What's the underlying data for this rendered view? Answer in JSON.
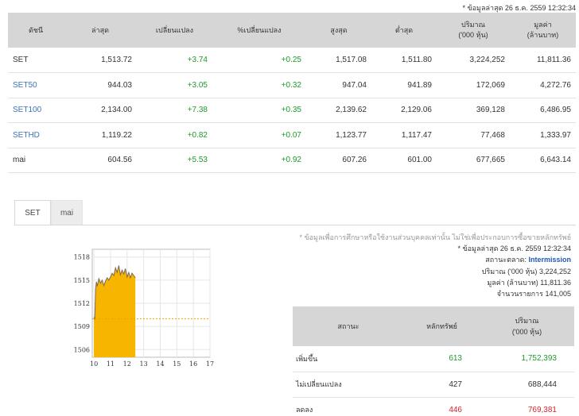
{
  "top_note": "* ข้อมูลล่าสุด 26 ธ.ค. 2559 12:32:34",
  "index_table": {
    "headers": [
      "ดัชนี",
      "ล่าสุด",
      "เปลี่ยนแปลง",
      "%เปลี่ยนแปลง",
      "สูงสุด",
      "ต่ำสุด",
      "ปริมาณ",
      "('000 หุ้น)",
      "มูลค่า",
      "(ล้านบาท)"
    ],
    "rows": [
      {
        "name": "SET",
        "last": "1,513.72",
        "change": "+3.74",
        "pct": "+0.25",
        "high": "1,517.08",
        "low": "1,511.80",
        "volume": "3,224,252",
        "value": "11,811.36"
      },
      {
        "name": "SET50",
        "last": "944.03",
        "change": "+3.05",
        "pct": "+0.32",
        "high": "947.04",
        "low": "941.89",
        "volume": "172,069",
        "value": "4,272.76"
      },
      {
        "name": "SET100",
        "last": "2,134.00",
        "change": "+7.38",
        "pct": "+0.35",
        "high": "2,139.62",
        "low": "2,129.06",
        "volume": "369,128",
        "value": "6,486.95"
      },
      {
        "name": "SETHD",
        "last": "1,119.22",
        "change": "+0.82",
        "pct": "+0.07",
        "high": "1,123.77",
        "low": "1,117.47",
        "volume": "77,468",
        "value": "1,333.97"
      },
      {
        "name": "mai",
        "last": "604.56",
        "change": "+5.53",
        "pct": "+0.92",
        "high": "607.26",
        "low": "601.00",
        "volume": "677,665",
        "value": "6,643.14"
      }
    ]
  },
  "tabs": [
    {
      "label": "SET",
      "active": true
    },
    {
      "label": "mai",
      "active": false
    }
  ],
  "info": {
    "disclaimer": "* ข้อมูลเพื่อการศึกษาหรือใช้งานส่วนบุคคลเท่านั้น ไม่ใช่เพื่อประกอบการซื้อขายหลักทรัพย์",
    "updated": "* ข้อมูลล่าสุด 26 ธ.ค. 2559 12:32:34",
    "market_status_label": "สถานะตลาด:",
    "market_status_value": "Intermission",
    "volume_label": "ปริมาณ ('000 หุ้น)",
    "volume_value": "3,224,252",
    "value_label": "มูลค่า (ล้านบาท)",
    "value_value": "11,811.36",
    "trades_label": "จำนวนรายการ",
    "trades_value": "141,005"
  },
  "stat_table": {
    "headers": [
      "สถานะ",
      "หลักทรัพย์",
      "ปริมาณ",
      "('000 หุ้น)"
    ],
    "rows": [
      {
        "label": "เพิ่มขึ้น",
        "count": "613",
        "volume": "1,752,393",
        "color": "#1f9a2b"
      },
      {
        "label": "ไม่เปลี่ยนแปลง",
        "count": "427",
        "volume": "688,444",
        "color": "#333333"
      },
      {
        "label": "ลดลง",
        "count": "446",
        "volume": "769,381",
        "color": "#d9262b"
      }
    ]
  },
  "chart_data": {
    "type": "area",
    "x_ticks": [
      "10",
      "11",
      "12",
      "13",
      "14",
      "15",
      "16",
      "17"
    ],
    "y_ticks": [
      "1518",
      "1515",
      "1512",
      "1509",
      "1506"
    ],
    "xlim": [
      9.9,
      17
    ],
    "ylim": [
      1505,
      1519
    ],
    "prev_close": 1509.98,
    "fill_color": "#f7b500",
    "x": [
      10.0,
      10.05,
      10.1,
      10.15,
      10.2,
      10.3,
      10.4,
      10.5,
      10.6,
      10.7,
      10.8,
      10.9,
      11.0,
      11.1,
      11.2,
      11.3,
      11.4,
      11.5,
      11.6,
      11.7,
      11.8,
      11.9,
      12.0,
      12.1,
      12.2,
      12.3,
      12.4,
      12.5
    ],
    "y": [
      1510.2,
      1510.0,
      1513.8,
      1514.8,
      1514.2,
      1515.2,
      1514.6,
      1515.0,
      1514.3,
      1514.9,
      1515.3,
      1515.0,
      1515.4,
      1515.9,
      1515.6,
      1516.6,
      1516.0,
      1516.9,
      1515.7,
      1516.3,
      1515.8,
      1516.5,
      1515.4,
      1516.0,
      1515.3,
      1515.9,
      1515.6,
      1515.3
    ]
  }
}
